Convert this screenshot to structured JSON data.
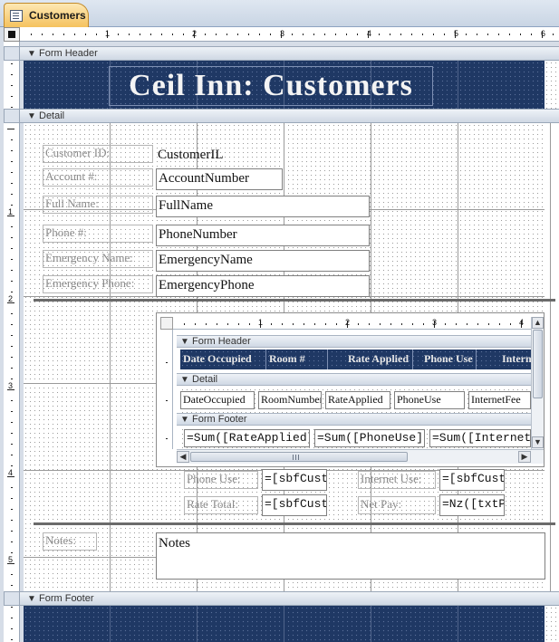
{
  "tab": {
    "title": "Customers",
    "icon": "form-icon"
  },
  "ruler": {
    "h_numbers": [
      "1",
      "2",
      "3",
      "4",
      "5",
      "6"
    ],
    "v_numbers": [
      "1",
      "2",
      "3",
      "4",
      "5"
    ]
  },
  "sections": {
    "form_header": "Form Header",
    "detail": "Detail",
    "form_footer": "Form Footer"
  },
  "header": {
    "title": "Ceil Inn: Customers"
  },
  "fields": [
    {
      "label": "Customer ID:",
      "value": "CustomerIL"
    },
    {
      "label": "Account #:",
      "value": "AccountNumber"
    },
    {
      "label": "Full Name:",
      "value": "FullName"
    },
    {
      "label": "Phone #:",
      "value": "PhoneNumber"
    },
    {
      "label": "Emergency Name:",
      "value": "EmergencyName"
    },
    {
      "label": "Emergency Phone:",
      "value": "EmergencyPhone"
    }
  ],
  "subform": {
    "sections": {
      "form_header": "Form Header",
      "detail": "Detail",
      "form_footer": "Form Footer"
    },
    "ruler_numbers": [
      "1",
      "2",
      "3",
      "4"
    ],
    "columns": [
      "Date Occupied",
      "Room #",
      "Rate Applied",
      "Phone Use",
      "Internet Use"
    ],
    "detail_fields": [
      "DateOccupied",
      "RoomNumber",
      "RateApplied",
      "PhoneUse",
      "InternetFee"
    ],
    "footer_expressions": [
      "=Sum([RateApplied])",
      "=Sum([PhoneUse])",
      "=Sum([InternetFe"
    ]
  },
  "totals": [
    {
      "label": "Phone Use:",
      "value": "=[sbfCusto"
    },
    {
      "label": "Internet Use:",
      "value": "=[sbfCusto"
    },
    {
      "label": "Rate Total:",
      "value": "=[sbfCusto"
    },
    {
      "label": "Net Pay:",
      "value": "=Nz([txtPh"
    }
  ],
  "notes": {
    "label": "Notes:",
    "value": "Notes"
  },
  "colors": {
    "header_bg": "#1f3864",
    "tab_bg": "#f5c25e",
    "section_bar": "#cfd8e4"
  }
}
